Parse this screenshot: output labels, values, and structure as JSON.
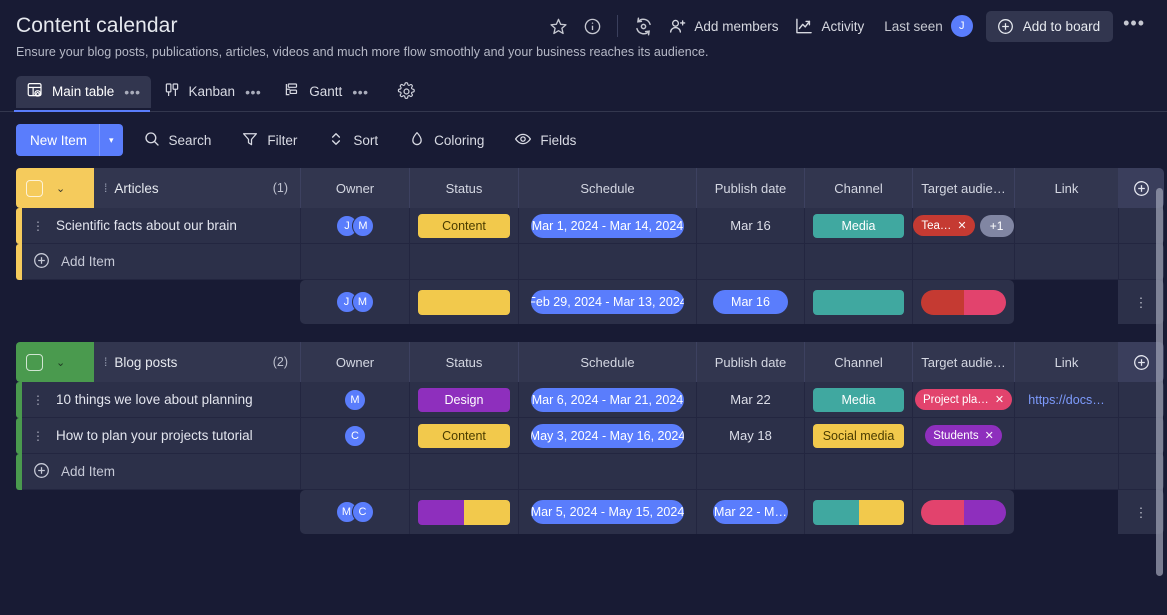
{
  "header": {
    "title": "Content calendar",
    "subtitle": "Ensure your blog posts, publications, articles, videos and much more flow smoothly and your business reaches its audience.",
    "star_icon": "star-icon",
    "info_icon": "info-icon",
    "refresh_icon": "activity-refresh-icon",
    "add_members_label": "Add members",
    "activity_label": "Activity",
    "last_seen_label": "Last seen",
    "last_seen_avatar": "J",
    "add_to_board_label": "Add to board",
    "more_label": "•••"
  },
  "tabs": [
    {
      "label": "Main table",
      "icon": "main-table-icon",
      "dots": "•••",
      "active": true
    },
    {
      "label": "Kanban",
      "icon": "kanban-icon",
      "dots": "•••",
      "active": false
    },
    {
      "label": "Gantt",
      "icon": "gantt-icon",
      "dots": "•••",
      "active": false
    }
  ],
  "tabs_settings_icon": "gear-icon",
  "toolbar": {
    "new_item_label": "New Item",
    "new_item_caret": "▾",
    "search_label": "Search",
    "filter_label": "Filter",
    "sort_label": "Sort",
    "coloring_label": "Coloring",
    "fields_label": "Fields"
  },
  "columns": [
    "Owner",
    "Status",
    "Schedule",
    "Publish date",
    "Channel",
    "Target audie…",
    "Link"
  ],
  "groups": [
    {
      "name": "Articles",
      "count": "(1)",
      "color": "#f5cb5c",
      "caret": "⌄",
      "add_item_label": "Add Item",
      "rows": [
        {
          "name": "Scientific facts about our brain",
          "owners": [
            "J",
            "M"
          ],
          "status": {
            "label": "Content",
            "class": "status-content"
          },
          "schedule": "Mar 1, 2024 - Mar 14, 2024",
          "publish_date": "Mar 16",
          "channel": {
            "label": "Media",
            "class": "channel-media"
          },
          "target": [
            {
              "label": "Tea…",
              "class": "tag-red"
            }
          ],
          "target_more": "+1",
          "link": ""
        }
      ],
      "summary": {
        "owners": [
          "J",
          "M"
        ],
        "status_bar": [
          {
            "color": "#f2c94c",
            "pct": 100
          }
        ],
        "schedule": "Feb 29, 2024 - Mar 13, 2024",
        "publish": "Mar 16",
        "channel_bar": [
          {
            "color": "#40a8a0",
            "pct": 100
          }
        ],
        "target_bar": [
          {
            "color": "#c53a32",
            "pct": 50
          },
          {
            "color": "#e2436d",
            "pct": 50
          }
        ]
      }
    },
    {
      "name": "Blog posts",
      "count": "(2)",
      "color": "#4a9a4e",
      "caret": "⌄",
      "add_item_label": "Add Item",
      "rows": [
        {
          "name": "10 things we love about planning",
          "owners": [
            "M"
          ],
          "status": {
            "label": "Design",
            "class": "status-design"
          },
          "schedule": "Mar 6, 2024 - Mar 21, 2024",
          "publish_date": "Mar 22",
          "channel": {
            "label": "Media",
            "class": "channel-media"
          },
          "target": [
            {
              "label": "Project pla…",
              "class": "tag-pink"
            }
          ],
          "target_more": "",
          "link": "https://docs…"
        },
        {
          "name": "How to plan your projects tutorial",
          "owners": [
            "C"
          ],
          "status": {
            "label": "Content",
            "class": "status-content"
          },
          "schedule": "May 3, 2024 - May 16, 2024",
          "publish_date": "May 18",
          "channel": {
            "label": "Social media",
            "class": "channel-social"
          },
          "target": [
            {
              "label": "Students",
              "class": "tag-purple"
            }
          ],
          "target_more": "",
          "link": ""
        }
      ],
      "summary": {
        "owners": [
          "M",
          "C"
        ],
        "status_bar": [
          {
            "color": "#8e2fbd",
            "pct": 50
          },
          {
            "color": "#f2c94c",
            "pct": 50
          }
        ],
        "schedule": "Mar 5, 2024 - May 15, 2024",
        "publish": "Mar 22 - M…",
        "channel_bar": [
          {
            "color": "#40a8a0",
            "pct": 50
          },
          {
            "color": "#f2c94c",
            "pct": 50
          }
        ],
        "target_bar": [
          {
            "color": "#e2436d",
            "pct": 50
          },
          {
            "color": "#8e2fbd",
            "pct": 50
          }
        ]
      }
    }
  ],
  "colors": {
    "accent": "#5a7dfc",
    "background": "#181b34",
    "row": "#2c3049",
    "header_cell": "#32364f"
  }
}
